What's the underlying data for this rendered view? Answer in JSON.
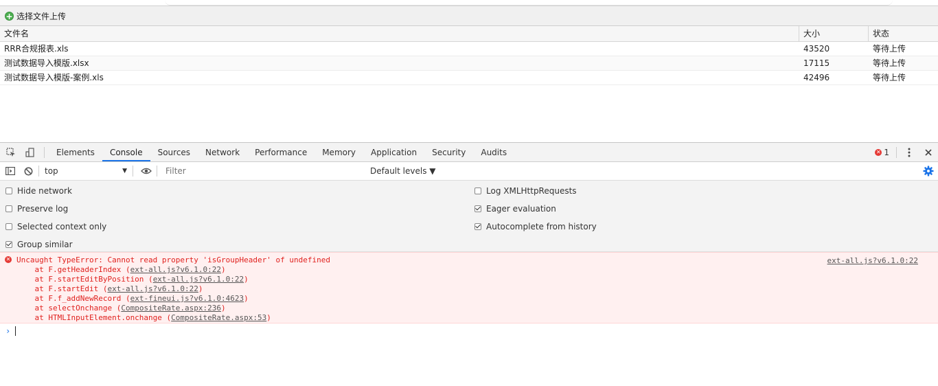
{
  "upload": {
    "button_label": "选择文件上传",
    "columns": [
      "文件名",
      "大小",
      "状态"
    ],
    "rows": [
      {
        "name": "RRR合规报表.xls",
        "size": "43520",
        "status": "等待上传"
      },
      {
        "name": "测试数据导入模版.xlsx",
        "size": "17115",
        "status": "等待上传"
      },
      {
        "name": "测试数据导入模版-案例.xls",
        "size": "42496",
        "status": "等待上传"
      }
    ]
  },
  "devtools": {
    "tabs": [
      "Elements",
      "Console",
      "Sources",
      "Network",
      "Performance",
      "Memory",
      "Application",
      "Security",
      "Audits"
    ],
    "active_tab": "Console",
    "error_count": "1",
    "context": "top",
    "filter_placeholder": "Filter",
    "levels_label": "Default levels ▼",
    "settings": {
      "hide_network": {
        "label": "Hide network",
        "checked": false
      },
      "preserve_log": {
        "label": "Preserve log",
        "checked": false
      },
      "selected_context_only": {
        "label": "Selected context only",
        "checked": false
      },
      "group_similar": {
        "label": "Group similar",
        "checked": true
      },
      "log_xhr": {
        "label": "Log XMLHttpRequests",
        "checked": false
      },
      "eager_evaluation": {
        "label": "Eager evaluation",
        "checked": true
      },
      "autocomplete_history": {
        "label": "Autocomplete from history",
        "checked": true
      }
    },
    "error": {
      "message": "Uncaught TypeError: Cannot read property 'isGroupHeader' of undefined",
      "source": "ext-all.js?v6.1.0:22",
      "stack": [
        {
          "prefix": "    at F.getHeaderIndex (",
          "link": "ext-all.js?v6.1.0:22",
          "suffix": ")"
        },
        {
          "prefix": "    at F.startEditByPosition (",
          "link": "ext-all.js?v6.1.0:22",
          "suffix": ")"
        },
        {
          "prefix": "    at F.startEdit (",
          "link": "ext-all.js?v6.1.0:22",
          "suffix": ")"
        },
        {
          "prefix": "    at F.f_addNewRecord (",
          "link": "ext-fineui.js?v6.1.0:4623",
          "suffix": ")"
        },
        {
          "prefix": "    at selectOnchange (",
          "link": "CompositeRate.aspx:236",
          "suffix": ")"
        },
        {
          "prefix": "    at HTMLInputElement.onchange (",
          "link": "CompositeRate.aspx:53",
          "suffix": ")"
        }
      ]
    },
    "prompt_symbol": "›",
    "colors": {
      "accent": "#1a73e8",
      "error": "#e0211e",
      "error_bg": "#fff0f0"
    }
  }
}
